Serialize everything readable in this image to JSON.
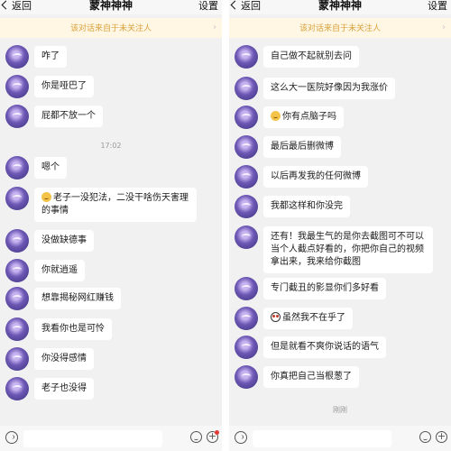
{
  "left": {
    "header": {
      "back_label": "返回",
      "title": "蒙神神神",
      "settings_label": "设置"
    },
    "notice": "该对话来自于未关注人",
    "time_top": "17:02",
    "messages": [
      {
        "text": "咋了"
      },
      {
        "text": "你是哑巴了"
      },
      {
        "text": "屁都不放一个"
      },
      {
        "text": "嗯个"
      },
      {
        "text": "老子一没犯法，二没干啥伤天害理的事情",
        "emoji": true
      },
      {
        "text": "没做缺德事"
      },
      {
        "text": "你就逍遥"
      },
      {
        "text": "想靠揭秘网红赚钱"
      },
      {
        "text": "我看你也是可怜"
      },
      {
        "text": "你没得感情"
      },
      {
        "text": "老子也没得"
      }
    ],
    "input_placeholder": ""
  },
  "right": {
    "header": {
      "back_label": "返回",
      "title": "蒙神神神",
      "settings_label": "设置"
    },
    "notice": "该对话来自于未关注人",
    "time_bottom": "刚刚",
    "messages": [
      {
        "text": "自己做不起就别去问"
      },
      {
        "text": "这么大一医院好像因为我涨价"
      },
      {
        "text": "你有点脑子吗",
        "emoji": true
      },
      {
        "text": "最后最后删微博"
      },
      {
        "text": "以后再发我的任何微博"
      },
      {
        "text": "我都这样和你没完"
      },
      {
        "text": "还有！我最生气的是你去截图可不可以当个人截点好看的，你把你自己的视频拿出来，我来给你截图"
      },
      {
        "text": "专门截丑的影显你们多好看"
      },
      {
        "text": "虽然我不在乎了",
        "emoji_alt": true
      },
      {
        "text": "但是就看不爽你说话的语气"
      },
      {
        "text": "你真把自己当根葱了"
      }
    ],
    "input_placeholder": ""
  }
}
